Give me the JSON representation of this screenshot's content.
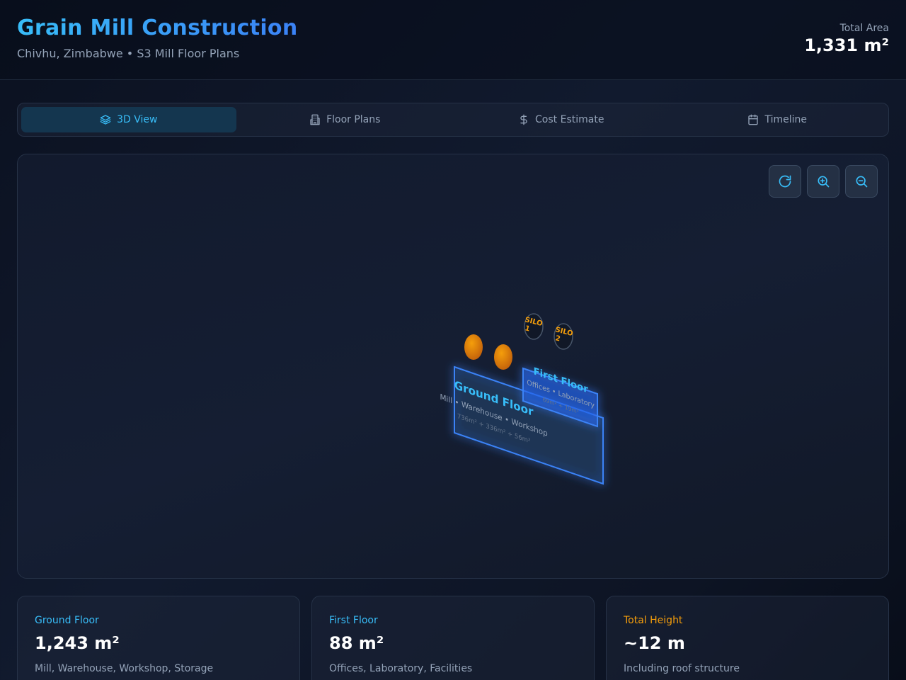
{
  "header": {
    "title": "Grain Mill Construction",
    "subtitle": "Chivhu, Zimbabwe • S3 Mill Floor Plans",
    "total_area_label": "Total Area",
    "total_area_value": "1,331 m²"
  },
  "tabs": [
    {
      "label": "3D View",
      "icon": "layers-icon",
      "active": true
    },
    {
      "label": "Floor Plans",
      "icon": "building-icon",
      "active": false
    },
    {
      "label": "Cost Estimate",
      "icon": "dollar-icon",
      "active": false
    },
    {
      "label": "Timeline",
      "icon": "calendar-icon",
      "active": false
    }
  ],
  "viewer": {
    "controls": [
      {
        "name": "rotate-button",
        "icon": "refresh-icon"
      },
      {
        "name": "zoom-in-button",
        "icon": "zoom-in-icon"
      },
      {
        "name": "zoom-out-button",
        "icon": "zoom-out-icon"
      }
    ],
    "ground_floor": {
      "title": "Ground Floor",
      "rooms": "Mill • Warehouse • Workshop",
      "areas": "736m² + 336m² + 56m²"
    },
    "first_floor": {
      "title": "First Floor",
      "rooms": "Offices • Laboratory",
      "areas": "69m² + 19m²"
    },
    "silos": [
      {
        "label_line1": "SILO",
        "label_line2": "1"
      },
      {
        "label_line1": "SILO",
        "label_line2": "2"
      }
    ]
  },
  "cards": [
    {
      "label": "Ground Floor",
      "value": "1,243 m²",
      "desc": "Mill, Warehouse, Workshop, Storage",
      "accent": "#38bdf8"
    },
    {
      "label": "First Floor",
      "value": "88 m²",
      "desc": "Offices, Laboratory, Facilities",
      "accent": "#38bdf8"
    },
    {
      "label": "Total Height",
      "value": "~12 m",
      "desc": "Including roof structure",
      "accent": "#f59e0b"
    }
  ],
  "colors": {
    "accent": "#38bdf8",
    "silo": "#f59e0b",
    "text_muted": "#94a3b8"
  }
}
